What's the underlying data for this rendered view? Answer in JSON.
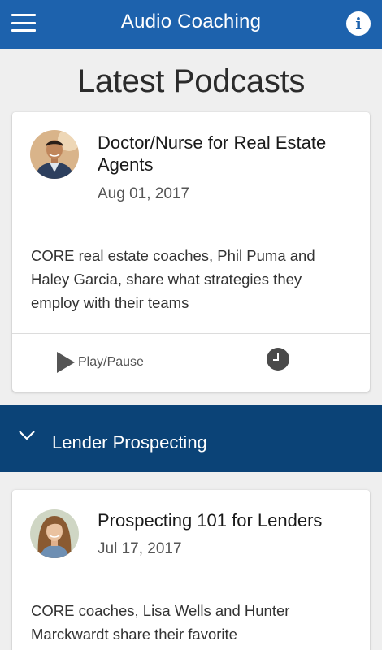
{
  "header": {
    "title": "Audio Coaching",
    "menu_icon": "hamburger-menu-icon",
    "info_icon": "info-icon",
    "info_glyph": "i",
    "color": "#1d62ad"
  },
  "page_title": "Latest Podcasts",
  "podcasts": [
    {
      "title": "Doctor/Nurse for Real Estate Agents",
      "date": "Aug 01, 2017",
      "description": "CORE real estate coaches, Phil Puma and Haley Garcia, share what strategies they employ with their teams",
      "play_label": "Play/Pause",
      "avatar": "male-coach-avatar"
    }
  ],
  "section": {
    "label": "Lender Prospecting",
    "icon": "chevron-down-icon",
    "color": "#0b4377"
  },
  "section_podcasts": [
    {
      "title": "Prospecting 101 for Lenders",
      "date": "Jul 17, 2017",
      "description": "CORE coaches, Lisa Wells and Hunter Marckwardt share their favorite",
      "avatar": "female-coach-avatar"
    }
  ]
}
